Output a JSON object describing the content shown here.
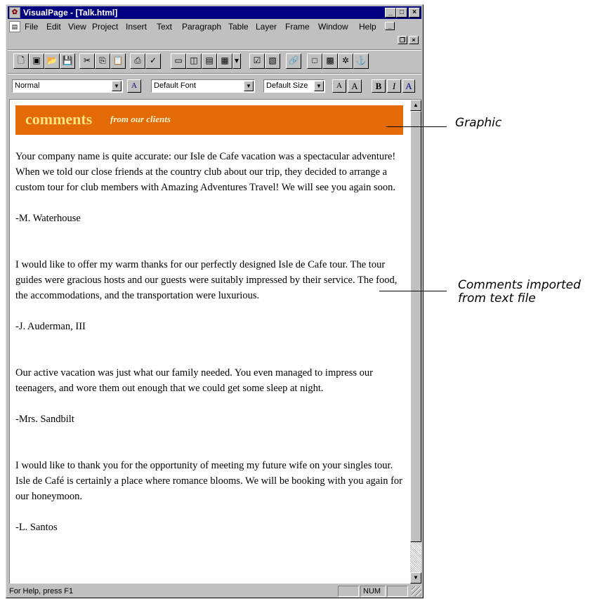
{
  "window": {
    "title": "VisualPage - [Talk.html]"
  },
  "menu": [
    "File",
    "Edit",
    "View",
    "Project",
    "Insert",
    "Text",
    "Paragraph",
    "Table",
    "Layer",
    "Frame",
    "Window",
    "Help"
  ],
  "format_bar": {
    "paragraph_style": "Normal",
    "font": "Default Font",
    "size": "Default Size"
  },
  "banner": {
    "headline": "comments",
    "subhead": "from our clients"
  },
  "comments": [
    {
      "text": "Your company name is quite accurate: our Isle de Cafe vacation was a spectacular adventure! When we told our close friends at the country club about our trip, they decided to arrange a custom tour for club members with Amazing Adventures Travel! We will see you again soon.",
      "author": "-M. Waterhouse"
    },
    {
      "text": "I would like to offer my warm thanks for our perfectly designed Isle de Cafe tour. The tour guides were gracious hosts and our guests were suitably impressed by their service. The food, the accommodations, and the transportation were luxurious.",
      "author": "-J. Auderman, III"
    },
    {
      "text": "Our active vacation was just what our family needed. You even managed to impress our teenagers, and wore them out enough that we could get some sleep at night.",
      "author": "-Mrs. Sandbilt"
    },
    {
      "text": "I would like to thank you for the opportunity of meeting my future wife on your singles tour. Isle de Café is certainly a place where romance blooms. We will be booking with you again for our honeymoon.",
      "author": "-L. Santos"
    }
  ],
  "status": {
    "message": "For Help, press F1",
    "num": "NUM"
  },
  "callouts": {
    "graphic": "Graphic",
    "comments_line1": "Comments imported",
    "comments_line2": "from text file"
  }
}
